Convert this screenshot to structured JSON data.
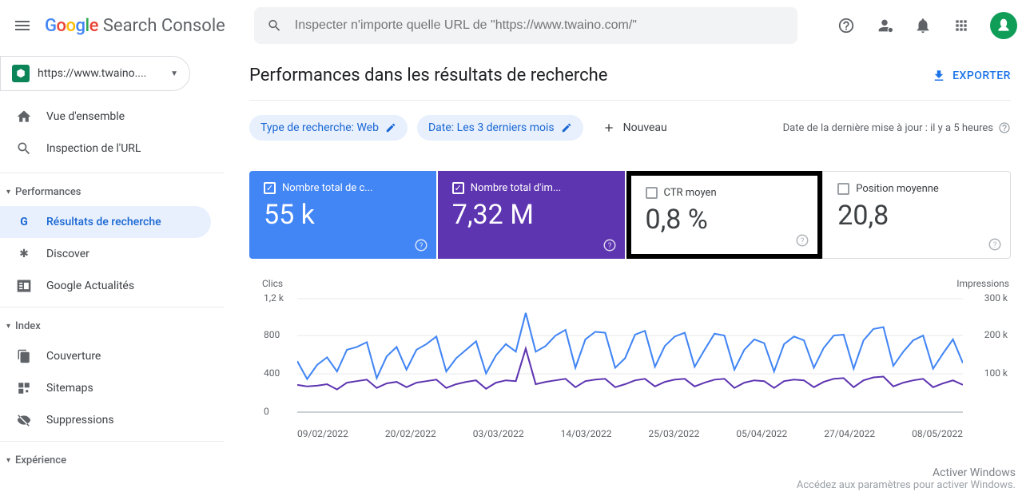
{
  "header": {
    "product_name": "Search Console",
    "search_placeholder": "Inspecter n'importe quelle URL de \"https://www.twaino.com/\""
  },
  "property": {
    "url": "https://www.twaino...."
  },
  "sidebar": {
    "overview": "Vue d'ensemble",
    "url_inspection": "Inspection de l'URL",
    "section_perf": "Performances",
    "results": "Résultats de recherche",
    "discover": "Discover",
    "gnews": "Google Actualités",
    "section_index": "Index",
    "coverage": "Couverture",
    "sitemaps": "Sitemaps",
    "removals": "Suppressions",
    "section_experience": "Expérience"
  },
  "page": {
    "title": "Performances dans les résultats de recherche",
    "export": "EXPORTER"
  },
  "filters": {
    "search_type": "Type de recherche: Web",
    "date": "Date: Les 3 derniers mois",
    "add_new": "Nouveau",
    "last_update": "Date de la dernière mise à jour : il y a 5 heures"
  },
  "metrics": {
    "clicks_label": "Nombre total de c...",
    "clicks_value": "55 k",
    "impressions_label": "Nombre total d'im...",
    "impressions_value": "7,32 M",
    "ctr_label": "CTR moyen",
    "ctr_value": "0,8 %",
    "position_label": "Position moyenne",
    "position_value": "20,8"
  },
  "chart": {
    "left_axis": "Clics",
    "right_axis": "Impressions",
    "left_ticks": [
      "1,2 k",
      "800",
      "400",
      "0"
    ],
    "right_ticks": [
      "300 k",
      "200 k",
      "100 k",
      ""
    ],
    "x_ticks": [
      "09/02/2022",
      "20/02/2022",
      "03/03/2022",
      "14/03/2022",
      "25/03/2022",
      "05/04/2022",
      "27/04/2022",
      "08/05/2022"
    ]
  },
  "watermark": {
    "line1": "Activer Windows",
    "line2": "Accédez aux paramètres pour activer Windows."
  },
  "chart_data": {
    "type": "line",
    "title": "Performances dans les résultats de recherche",
    "x_dates": [
      "09/02/2022",
      "20/02/2022",
      "03/03/2022",
      "14/03/2022",
      "25/03/2022",
      "05/04/2022",
      "27/04/2022",
      "08/05/2022"
    ],
    "left_axis": {
      "label": "Clics",
      "range": [
        0,
        1200
      ]
    },
    "right_axis": {
      "label": "Impressions",
      "range": [
        0,
        300000
      ]
    },
    "series": [
      {
        "name": "Clics",
        "axis": "left",
        "color": "#4285f4",
        "values": [
          540,
          350,
          500,
          580,
          430,
          660,
          690,
          740,
          360,
          590,
          690,
          450,
          660,
          720,
          800,
          430,
          570,
          660,
          750,
          410,
          600,
          720,
          640,
          1050,
          640,
          700,
          810,
          870,
          470,
          770,
          850,
          840,
          470,
          570,
          820,
          860,
          480,
          700,
          800,
          840,
          480,
          660,
          830,
          810,
          450,
          660,
          770,
          730,
          430,
          720,
          800,
          760,
          470,
          680,
          810,
          820,
          460,
          760,
          880,
          900,
          490,
          640,
          760,
          810,
          460,
          620,
          770,
          520
        ]
      },
      {
        "name": "Impressions",
        "axis": "right",
        "color": "#5e35b1",
        "values": [
          72000,
          68000,
          70000,
          74000,
          60000,
          78000,
          82000,
          86000,
          64000,
          76000,
          80000,
          66000,
          78000,
          82000,
          86000,
          64000,
          74000,
          80000,
          84000,
          62000,
          78000,
          84000,
          82000,
          168000,
          74000,
          80000,
          84000,
          88000,
          66000,
          82000,
          86000,
          88000,
          66000,
          74000,
          84000,
          88000,
          68000,
          80000,
          86000,
          88000,
          68000,
          78000,
          86000,
          88000,
          64000,
          78000,
          84000,
          82000,
          64000,
          82000,
          86000,
          84000,
          66000,
          80000,
          88000,
          90000,
          66000,
          84000,
          92000,
          94000,
          68000,
          78000,
          84000,
          88000,
          66000,
          76000,
          84000,
          72000
        ]
      }
    ]
  }
}
